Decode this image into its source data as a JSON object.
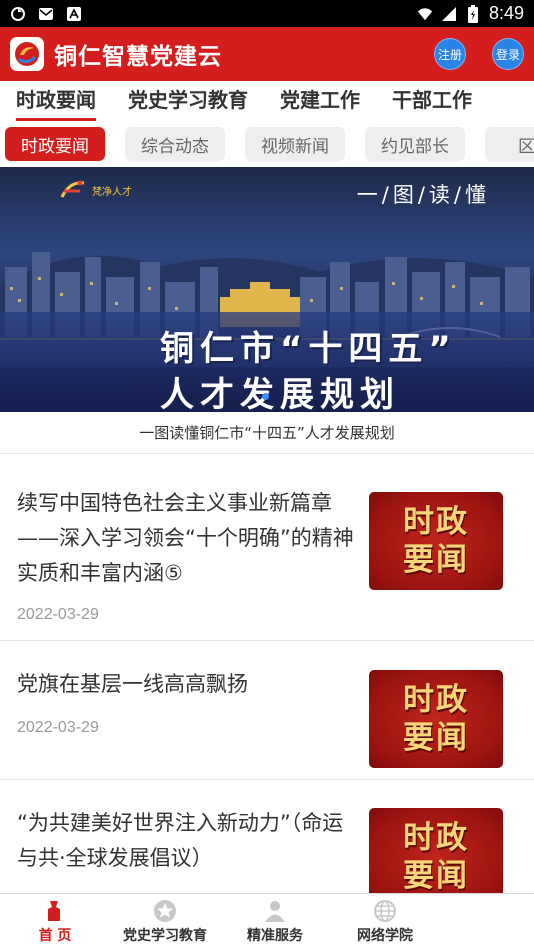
{
  "status_bar": {
    "time": "8:49"
  },
  "header": {
    "title": "铜仁智慧党建云",
    "register": "注册",
    "login": "登录"
  },
  "main_tabs": [
    {
      "label": "时政要闻"
    },
    {
      "label": "党史学习教育"
    },
    {
      "label": "党建工作"
    },
    {
      "label": "干部工作"
    }
  ],
  "sub_tabs": [
    {
      "label": "时政要闻"
    },
    {
      "label": "综合动态"
    },
    {
      "label": "视频新闻"
    },
    {
      "label": "约见部长"
    },
    {
      "label": "区县"
    }
  ],
  "banner": {
    "logo_text": "梵净人才",
    "tag": "一/图/读/懂",
    "headline_1": "铜仁市“十四五”",
    "headline_2": "人才发展规划",
    "caption": "一图读懂铜仁市“十四五”人才发展规划"
  },
  "news": [
    {
      "title": "续写中国特色社会主义事业新篇章——深入学习领会“十个明确”的精神实质和丰富内涵⑤",
      "date": "2022-03-29",
      "thumb_line1": "时政",
      "thumb_line2": "要闻"
    },
    {
      "title": "党旗在基层一线高高飘扬",
      "date": "2022-03-29",
      "thumb_line1": "时政",
      "thumb_line2": "要闻"
    },
    {
      "title": "“为共建美好世界注入新动力”（命运与共·全球发展倡议）",
      "date": "",
      "thumb_line1": "时政",
      "thumb_line2": "要闻"
    }
  ],
  "bottom_nav": [
    {
      "label": "首 页",
      "icon": "home-icon"
    },
    {
      "label": "党史学习教育",
      "icon": "star-icon"
    },
    {
      "label": "精准服务",
      "icon": "person-icon"
    },
    {
      "label": "网络学院",
      "icon": "globe-icon"
    }
  ],
  "colors": {
    "brand_red": "#d41e1e",
    "button_blue": "#2a84e8",
    "thumb_gold": "#f8d77a"
  }
}
